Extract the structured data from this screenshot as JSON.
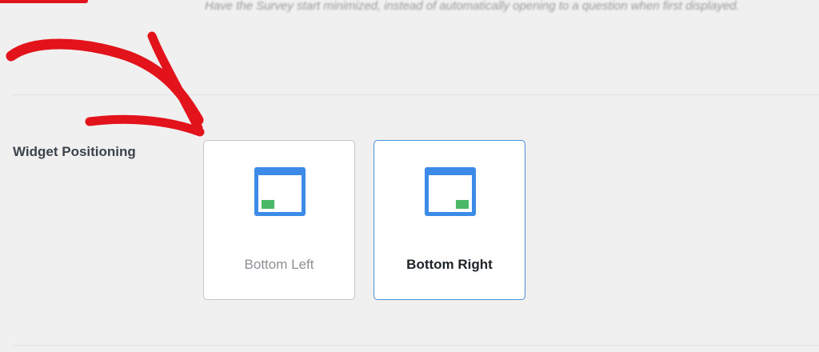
{
  "previous_setting": {
    "description": "Have the Survey start minimized, instead of automatically opening to a question when first displayed."
  },
  "widget_positioning": {
    "label": "Widget Positioning",
    "options": [
      {
        "label": "Bottom Left",
        "selected": false
      },
      {
        "label": "Bottom Right",
        "selected": true
      }
    ]
  },
  "colors": {
    "icon_blue": "#3d8be8",
    "icon_green": "#4ab866",
    "selected_border": "#4a90d9",
    "arrow_red": "#e3131b"
  }
}
